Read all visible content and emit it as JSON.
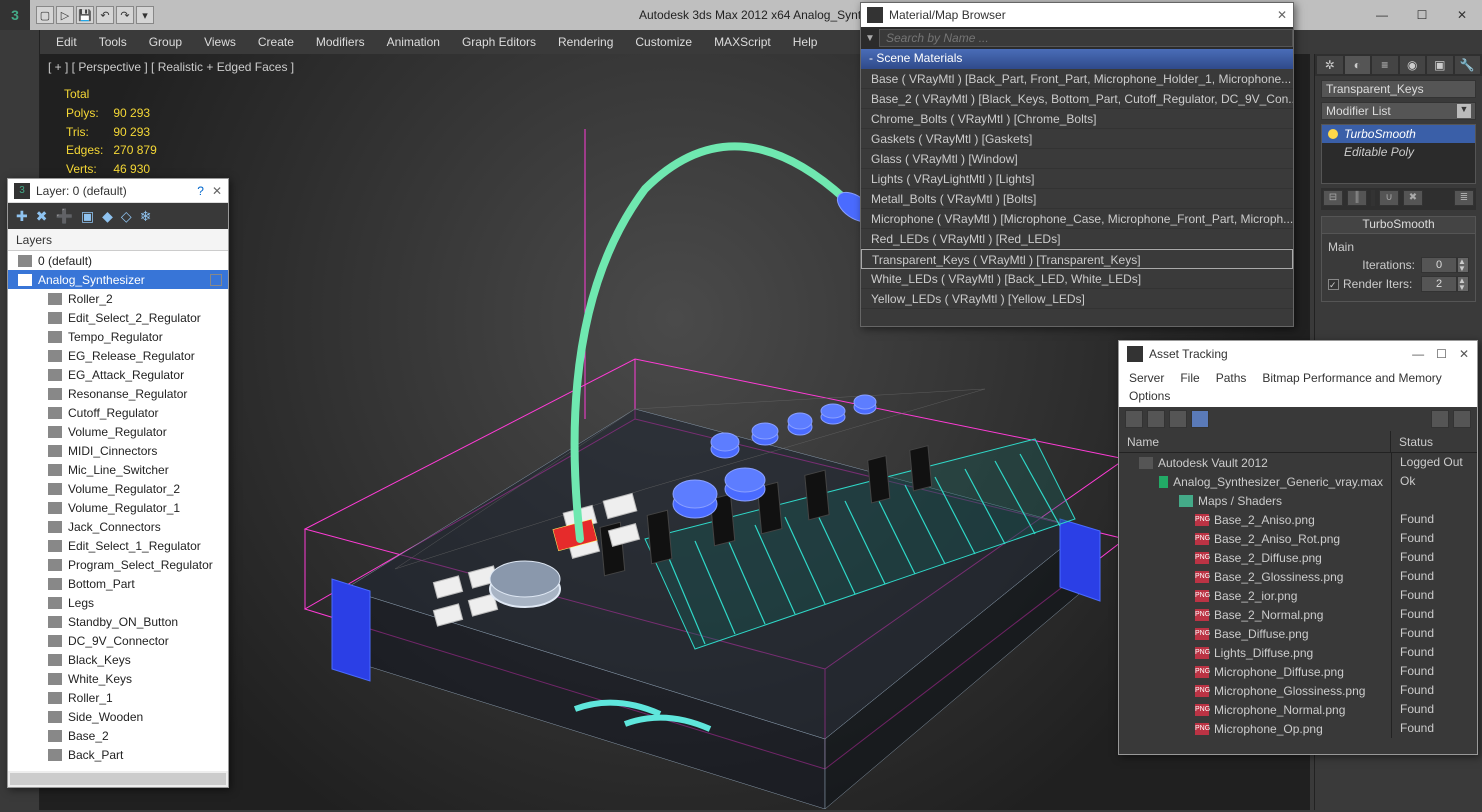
{
  "title": "Autodesk 3ds Max  2012 x64        Analog_Synthesizer_Generic_vray.max",
  "menu": [
    "Edit",
    "Tools",
    "Group",
    "Views",
    "Create",
    "Modifiers",
    "Animation",
    "Graph Editors",
    "Rendering",
    "Customize",
    "MAXScript",
    "Help"
  ],
  "viewport_label": "[ + ]  [ Perspective ]  [ Realistic + Edged Faces ]",
  "stats": {
    "header": "Total",
    "rows": [
      {
        "l": "Polys:",
        "v": "90 293"
      },
      {
        "l": "Tris:",
        "v": "90 293"
      },
      {
        "l": "Edges:",
        "v": "270 879"
      },
      {
        "l": "Verts:",
        "v": "46 930"
      }
    ]
  },
  "layer_panel": {
    "title": "Layer: 0 (default)",
    "header": "Layers",
    "rows": [
      {
        "t": "0 (default)",
        "lvl": 0,
        "sel": false
      },
      {
        "t": "Analog_Synthesizer",
        "lvl": 0,
        "sel": true,
        "cb": true
      },
      {
        "t": "Roller_2",
        "lvl": 1
      },
      {
        "t": "Edit_Select_2_Regulator",
        "lvl": 1
      },
      {
        "t": "Tempo_Regulator",
        "lvl": 1
      },
      {
        "t": "EG_Release_Regulator",
        "lvl": 1
      },
      {
        "t": "EG_Attack_Regulator",
        "lvl": 1
      },
      {
        "t": "Resonanse_Regulator",
        "lvl": 1
      },
      {
        "t": "Cutoff_Regulator",
        "lvl": 1
      },
      {
        "t": "Volume_Regulator",
        "lvl": 1
      },
      {
        "t": "MIDI_Cinnectors",
        "lvl": 1
      },
      {
        "t": "Mic_Line_Switcher",
        "lvl": 1
      },
      {
        "t": "Volume_Regulator_2",
        "lvl": 1
      },
      {
        "t": "Volume_Regulator_1",
        "lvl": 1
      },
      {
        "t": "Jack_Connectors",
        "lvl": 1
      },
      {
        "t": "Edit_Select_1_Regulator",
        "lvl": 1
      },
      {
        "t": "Program_Select_Regulator",
        "lvl": 1
      },
      {
        "t": "Bottom_Part",
        "lvl": 1
      },
      {
        "t": "Legs",
        "lvl": 1
      },
      {
        "t": "Standby_ON_Button",
        "lvl": 1
      },
      {
        "t": "DC_9V_Connector",
        "lvl": 1
      },
      {
        "t": "Black_Keys",
        "lvl": 1
      },
      {
        "t": "White_Keys",
        "lvl": 1
      },
      {
        "t": "Roller_1",
        "lvl": 1
      },
      {
        "t": "Side_Wooden",
        "lvl": 1
      },
      {
        "t": "Base_2",
        "lvl": 1
      },
      {
        "t": "Back_Part",
        "lvl": 1
      }
    ]
  },
  "materials": {
    "title": "Material/Map Browser",
    "search_placeholder": "Search by Name ...",
    "section": "- Scene Materials",
    "rows": [
      "Base  ( VRayMtl )  [Back_Part, Front_Part, Microphone_Holder_1, Microphone...",
      "Base_2  ( VRayMtl )  [Black_Keys, Bottom_Part, Cutoff_Regulator, DC_9V_Con...",
      "Chrome_Bolts  ( VRayMtl )  [Chrome_Bolts]",
      "Gaskets   ( VRayMtl )  [Gaskets]",
      "Glass   ( VRayMtl )  [Window]",
      "Lights  ( VRayLightMtl )  [Lights]",
      "Metall_Bolts  ( VRayMtl )  [Bolts]",
      "Microphone  ( VRayMtl )  [Microphone_Case, Microphone_Front_Part, Microph...",
      "Red_LEDs  ( VRayMtl )  [Red_LEDs]",
      "Transparent_Keys  ( VRayMtl )  [Transparent_Keys]",
      "White_LEDs   ( VRayMtl )  [Back_LED, White_LEDs]",
      "Yellow_LEDs  ( VRayMtl )  [Yellow_LEDs]"
    ],
    "selected_index": 9
  },
  "right": {
    "object_name": "Transparent_Keys",
    "modlist_label": "Modifier List",
    "stack": [
      {
        "t": "TurboSmooth",
        "sel": true,
        "bulb": true
      },
      {
        "t": "Editable Poly",
        "sel": false,
        "bulb": false
      }
    ],
    "rollout": "TurboSmooth",
    "main_label": "Main",
    "iter_label": "Iterations:",
    "iter_val": "0",
    "render_label": "Render Iters:",
    "render_val": "2",
    "render_checked": true
  },
  "assets": {
    "title": "Asset Tracking",
    "menu": [
      "Server",
      "File",
      "Paths",
      "Bitmap Performance and Memory",
      "Options"
    ],
    "cols": [
      "Name",
      "Status"
    ],
    "rows": [
      {
        "t": "Autodesk Vault 2012",
        "s": "Logged Out",
        "lvl": 0,
        "ic": "vault"
      },
      {
        "t": "Analog_Synthesizer_Generic_vray.max",
        "s": "Ok",
        "lvl": 1,
        "ic": "max"
      },
      {
        "t": "Maps / Shaders",
        "s": "",
        "lvl": 2,
        "ic": "folder"
      },
      {
        "t": "Base_2_Aniso.png",
        "s": "Found",
        "lvl": 3,
        "ic": "png"
      },
      {
        "t": "Base_2_Aniso_Rot.png",
        "s": "Found",
        "lvl": 3,
        "ic": "png"
      },
      {
        "t": "Base_2_Diffuse.png",
        "s": "Found",
        "lvl": 3,
        "ic": "png"
      },
      {
        "t": "Base_2_Glossiness.png",
        "s": "Found",
        "lvl": 3,
        "ic": "png"
      },
      {
        "t": "Base_2_ior.png",
        "s": "Found",
        "lvl": 3,
        "ic": "png"
      },
      {
        "t": "Base_2_Normal.png",
        "s": "Found",
        "lvl": 3,
        "ic": "png"
      },
      {
        "t": "Base_Diffuse.png",
        "s": "Found",
        "lvl": 3,
        "ic": "png"
      },
      {
        "t": "Lights_Diffuse.png",
        "s": "Found",
        "lvl": 3,
        "ic": "png"
      },
      {
        "t": "Microphone_Diffuse.png",
        "s": "Found",
        "lvl": 3,
        "ic": "png"
      },
      {
        "t": "Microphone_Glossiness.png",
        "s": "Found",
        "lvl": 3,
        "ic": "png"
      },
      {
        "t": "Microphone_Normal.png",
        "s": "Found",
        "lvl": 3,
        "ic": "png"
      },
      {
        "t": "Microphone_Op.png",
        "s": "Found",
        "lvl": 3,
        "ic": "png"
      }
    ]
  }
}
